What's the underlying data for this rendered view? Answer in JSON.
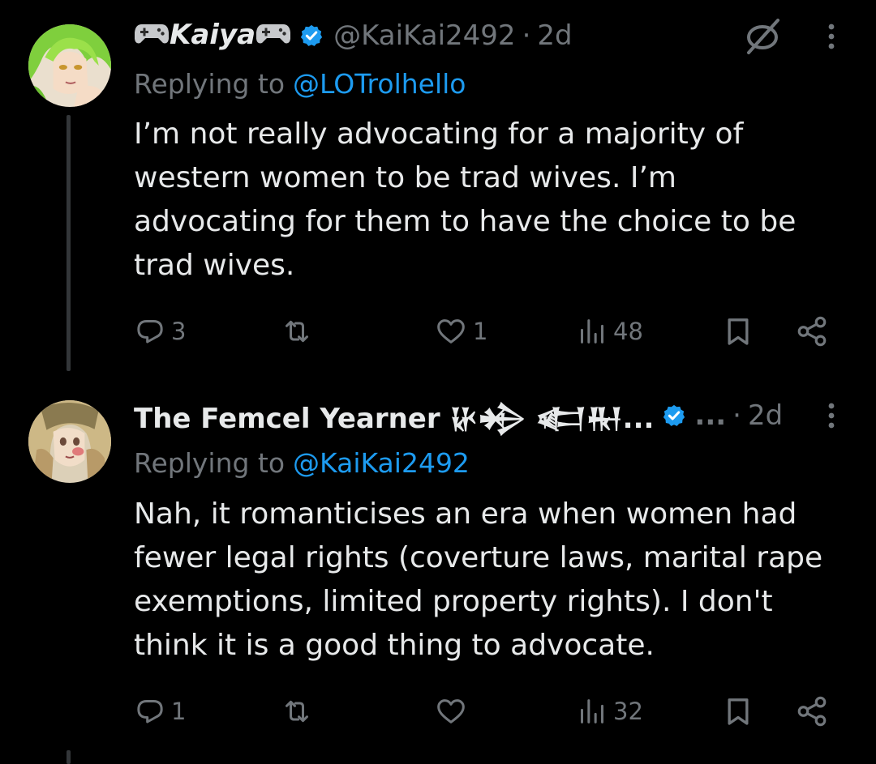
{
  "tweets": [
    {
      "display_name": "Kaiya",
      "handle": "@KaiKai2492",
      "dot": "·",
      "time": "2d",
      "replying_prefix": "Replying to",
      "replying_to": "@LOTrolhello",
      "text": "I’m not really advocating for a majority of\nwestern women to be trad wives. I’m\nadvocating for them to have the choice to be\ntrad wives.",
      "replies": "3",
      "reposts": "",
      "likes": "1",
      "views": "48"
    },
    {
      "display_name": "The Femcel Yearner 𒄩𒄈 𒅗𒊑...",
      "name_ellipsis": "...",
      "dot": "·",
      "time": "2d",
      "replying_prefix": "Replying to",
      "replying_to": "@KaiKai2492",
      "text": "Nah, it romanticises an era when women had\nfewer legal rights (coverture laws, marital rape\nexemptions, limited property rights). I don't\nthink it is a good thing to advocate.",
      "replies": "1",
      "reposts": "",
      "likes": "",
      "views": "32"
    }
  ],
  "colors": {
    "background": "#000000",
    "text": "#e7e9ea",
    "muted": "#71767b",
    "link": "#1d9bf0",
    "verified": "#1d9bf0",
    "thread_line": "#333639"
  },
  "icons": {
    "name_decoration": "game-controller-icon",
    "verified": "verified-badge-icon",
    "hidden": "hidden-reply-icon",
    "menu": "more-vertical-icon",
    "reply": "reply-icon",
    "repost": "repost-icon",
    "like": "heart-icon",
    "views": "views-icon",
    "bookmark": "bookmark-icon",
    "share": "share-icon"
  }
}
